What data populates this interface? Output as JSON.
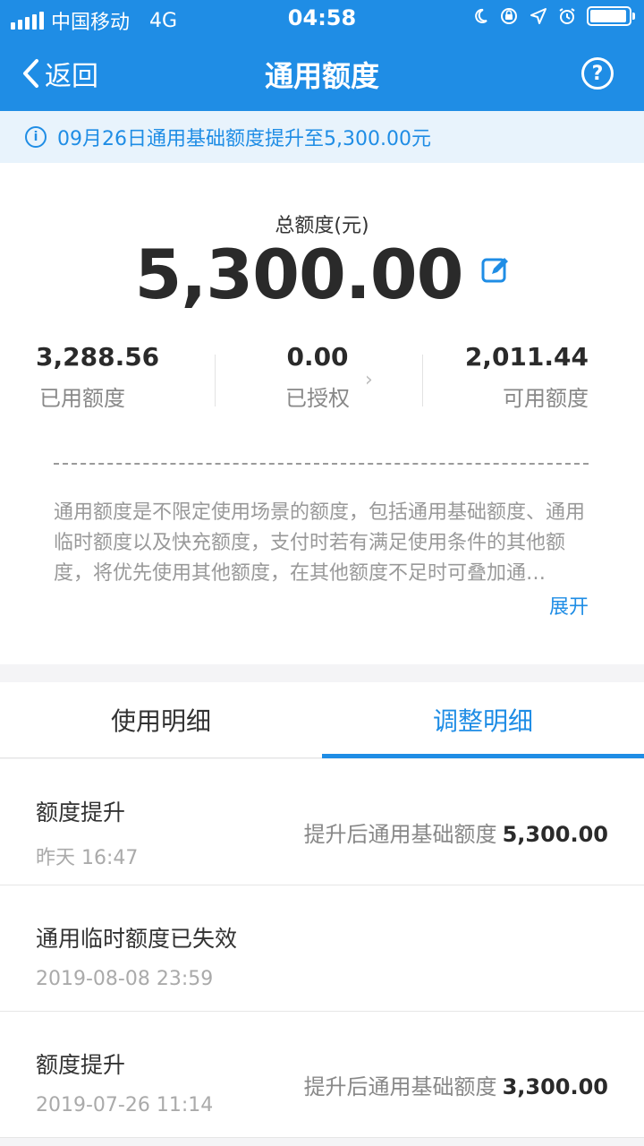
{
  "status_bar": {
    "carrier": "中国移动",
    "network": "4G",
    "time": "04:58"
  },
  "nav": {
    "back_label": "返回",
    "title": "通用额度",
    "help_glyph": "?"
  },
  "notice": {
    "icon": "info-icon",
    "text": "09月26日通用基础额度提升至5,300.00元"
  },
  "summary": {
    "total_label": "总额度(元)",
    "total_amount": "5,300.00",
    "used": {
      "value": "3,288.56",
      "label": "已用额度"
    },
    "authorized": {
      "value": "0.00",
      "label": "已授权"
    },
    "available": {
      "value": "2,011.44",
      "label": "可用额度"
    },
    "description": "通用额度是不限定使用场景的额度，包括通用基础额度、通用临时额度以及快充额度，支付时若有满足使用条件的其他额度，将优先使用其他额度，在其他额度不足时可叠加通…",
    "expand_label": "展开"
  },
  "tabs": [
    {
      "label": "使用明细",
      "active": false
    },
    {
      "label": "调整明细",
      "active": true
    }
  ],
  "records": [
    {
      "title": "额度提升",
      "time": "昨天 16:47",
      "detail_label": "提升后通用基础额度",
      "detail_value": "5,300.00"
    },
    {
      "title": "通用临时额度已失效",
      "time": "2019-08-08 23:59",
      "detail_label": "",
      "detail_value": ""
    },
    {
      "title": "额度提升",
      "time": "2019-07-26 11:14",
      "detail_label": "提升后通用基础额度",
      "detail_value": "3,300.00"
    }
  ],
  "colors": {
    "brand_blue": "#1f8de5",
    "notice_bg": "#e8f3fc"
  }
}
